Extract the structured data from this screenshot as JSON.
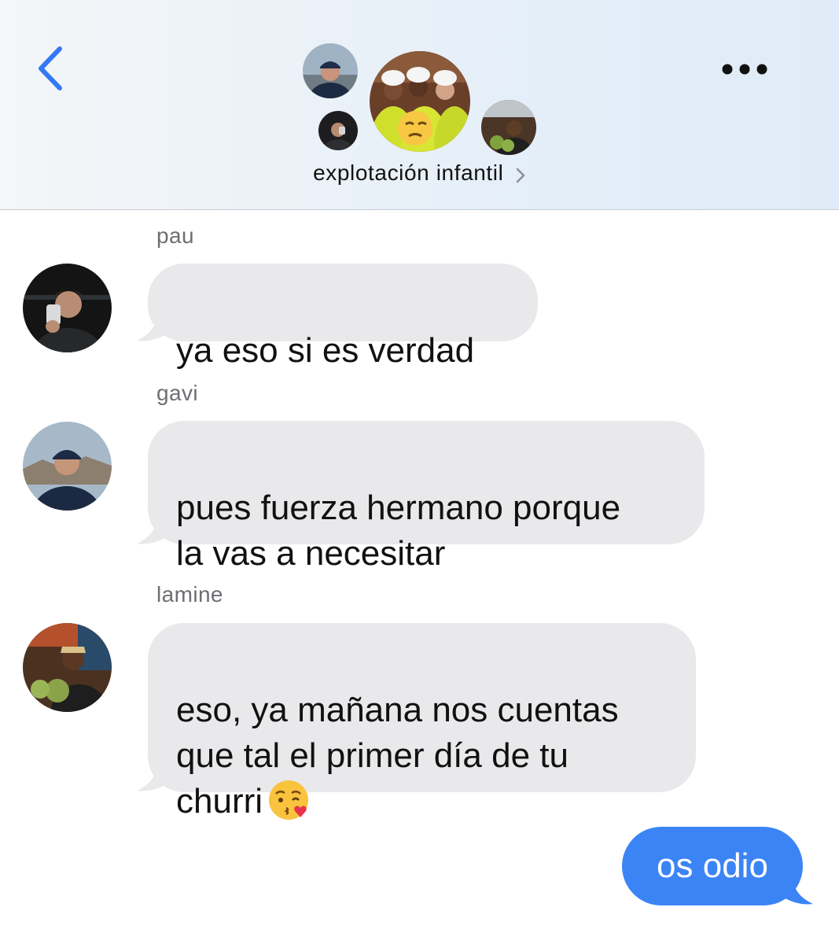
{
  "header": {
    "back_icon": "chevron-left-icon",
    "more_icon": "ellipsis-icon",
    "group_name": "explotación infantil",
    "chevron_icon": "chevron-right-icon"
  },
  "messages": [
    {
      "sender": "pau",
      "text": "ya eso si es verdad"
    },
    {
      "sender": "gavi",
      "text": "pues fuerza hermano porque\nla vas a necesitar"
    },
    {
      "sender": "lamine",
      "text": "eso, ya mañana nos cuentas\nque tal el primer día de tu\nchurri",
      "emoji": "kissing-face-heart-emoji"
    }
  ],
  "sent_message": {
    "text": "os odio"
  },
  "colors": {
    "accent": "#3b84f6",
    "back_icon": "#3478f6",
    "received_bubble": "#e9e9eb",
    "sender_name": "#6e6e73"
  }
}
